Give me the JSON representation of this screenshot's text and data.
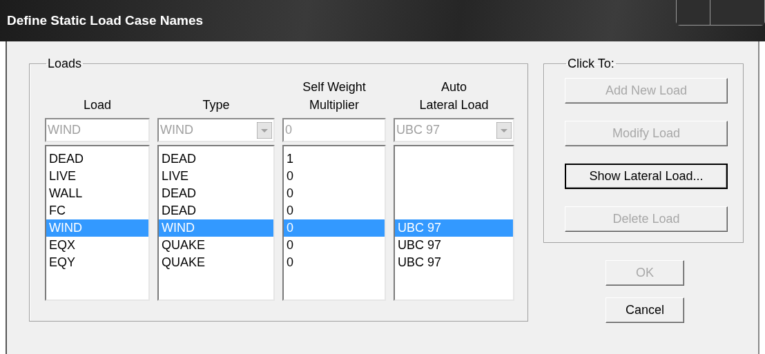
{
  "window": {
    "title": "Define Static Load Case Names"
  },
  "loads_group": {
    "label": "Loads",
    "columns": [
      {
        "header": "Load",
        "field": {
          "kind": "text",
          "value": "WIND",
          "disabled": true
        }
      },
      {
        "header": "Type",
        "field": {
          "kind": "combo",
          "value": "WIND",
          "disabled": true
        }
      },
      {
        "header": "Self Weight\nMultiplier",
        "field": {
          "kind": "text",
          "value": "0",
          "disabled": true
        }
      },
      {
        "header": "Auto\nLateral Load",
        "field": {
          "kind": "combo",
          "value": "UBC 97",
          "disabled": true
        }
      }
    ],
    "rows": [
      {
        "cells": [
          "DEAD",
          "DEAD",
          "1"
        ],
        "selected": false
      },
      {
        "cells": [
          "LIVE",
          "LIVE",
          "0"
        ],
        "selected": false
      },
      {
        "cells": [
          "WALL",
          "DEAD",
          "0"
        ],
        "selected": false
      },
      {
        "cells": [
          "FC",
          "DEAD",
          "0"
        ],
        "selected": false
      },
      {
        "cells": [
          "WIND",
          "WIND",
          "0",
          "UBC 97"
        ],
        "selected": true
      },
      {
        "cells": [
          "EQX",
          "QUAKE",
          "0",
          "UBC 97"
        ],
        "selected": false
      },
      {
        "cells": [
          "EQY",
          "QUAKE",
          "0",
          "UBC 97"
        ],
        "selected": false
      }
    ]
  },
  "click_to_group": {
    "label": "Click To:",
    "buttons": [
      {
        "label": "Add New Load",
        "disabled": true,
        "focused": false
      },
      {
        "label": "Modify Load",
        "disabled": true,
        "focused": false
      },
      {
        "label": "Show Lateral Load...",
        "disabled": false,
        "focused": true
      },
      {
        "label": "Delete Load",
        "disabled": true,
        "focused": false
      }
    ]
  },
  "dialog_buttons": [
    {
      "label": "OK",
      "disabled": true,
      "focused": false
    },
    {
      "label": "Cancel",
      "disabled": false,
      "focused": false
    }
  ]
}
